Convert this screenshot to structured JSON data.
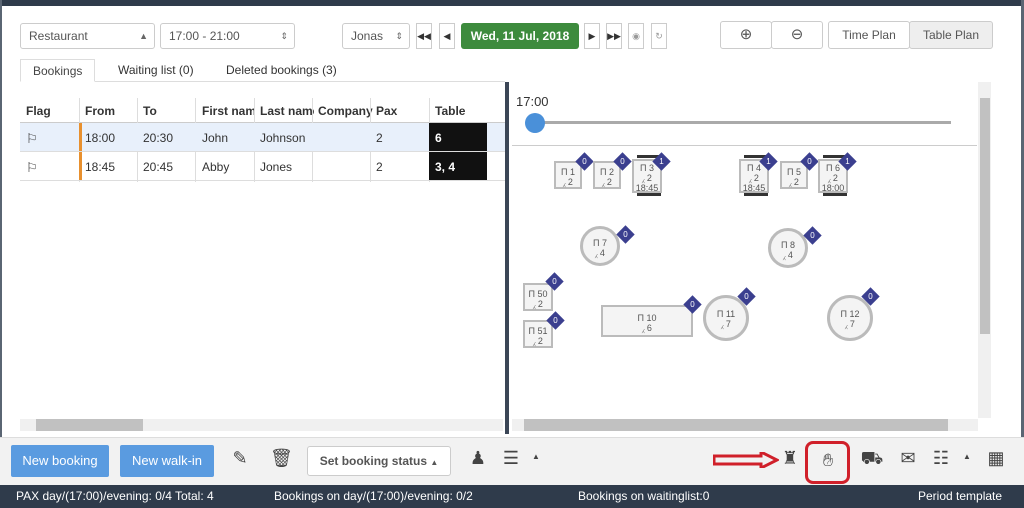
{
  "toolbar": {
    "area_select": "Restaurant",
    "time_select": "17:00 - 21:00",
    "user_select": "Jonas",
    "date": "Wed, 11 Jul, 2018",
    "time_plan": "Time Plan",
    "table_plan": "Table Plan"
  },
  "tabs": {
    "bookings": "Bookings",
    "waiting": "Waiting list (0)",
    "deleted": "Deleted bookings (3)"
  },
  "columns": {
    "flag": "Flag",
    "from": "From",
    "to": "To",
    "first": "First name",
    "last": "Last name",
    "company": "Company",
    "pax": "Pax",
    "table": "Table"
  },
  "rows": [
    {
      "from": "18:00",
      "to": "20:30",
      "first": "John",
      "last": "Johnson",
      "company": "",
      "pax": "2",
      "table": "6"
    },
    {
      "from": "18:45",
      "to": "20:45",
      "first": "Abby",
      "last": "Jones",
      "company": "",
      "pax": "2",
      "table": "3, 4"
    }
  ],
  "timeline": {
    "time": "17:00"
  },
  "tables": {
    "t1": {
      "name": "1",
      "seats": "2",
      "badge": "0"
    },
    "t2": {
      "name": "2",
      "seats": "2",
      "badge": "0"
    },
    "t3": {
      "name": "3",
      "seats": "2",
      "time": "18:45",
      "badge": "1"
    },
    "t4": {
      "name": "4",
      "seats": "2",
      "time": "18:45",
      "badge": "1"
    },
    "t5": {
      "name": "5",
      "seats": "2",
      "badge": "0"
    },
    "t6": {
      "name": "6",
      "seats": "2",
      "time": "18:00",
      "badge": "1"
    },
    "t7": {
      "name": "7",
      "seats": "4",
      "badge": "0"
    },
    "t8": {
      "name": "8",
      "seats": "4",
      "badge": "0"
    },
    "t50": {
      "name": "50",
      "seats": "2",
      "badge": "0"
    },
    "t51": {
      "name": "51",
      "seats": "2",
      "badge": "0"
    },
    "t10": {
      "name": "10",
      "seats": "6",
      "badge": "0"
    },
    "t11": {
      "name": "11",
      "seats": "7",
      "badge": "0"
    },
    "t12": {
      "name": "12",
      "seats": "7",
      "badge": "0"
    }
  },
  "actions": {
    "new_booking": "New booking",
    "new_walkin": "New walk-in",
    "set_status": "Set booking status"
  },
  "status": {
    "pax": "PAX day/(17:00)/evening: 0/4 Total: 4",
    "bookings": "Bookings on day/(17:00)/evening: 0/2",
    "waiting": "Bookings on waitinglist:0",
    "template": "Period template"
  },
  "colors": {
    "accent_green": "#3d8b3d",
    "blue_button": "#5a9be0",
    "highlight": "#d0202a",
    "badge": "#3b3f8f"
  }
}
